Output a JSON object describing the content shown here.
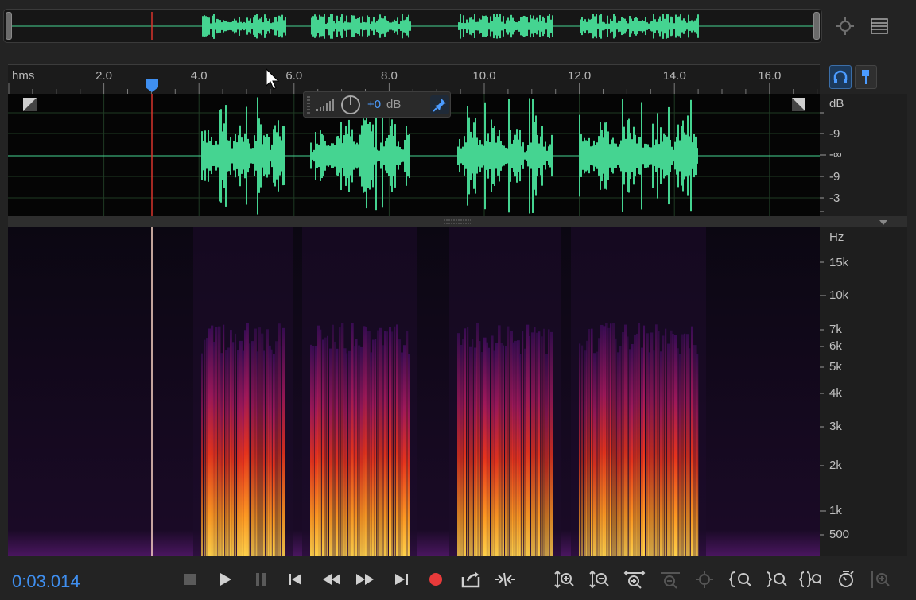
{
  "ruler": {
    "unit_label": "hms",
    "ticks": [
      {
        "value": 2.0,
        "label": "2.0"
      },
      {
        "value": 4.0,
        "label": "4.0"
      },
      {
        "value": 6.0,
        "label": "6.0"
      },
      {
        "value": 8.0,
        "label": "8.0"
      },
      {
        "value": 10.0,
        "label": "10.0"
      },
      {
        "value": 12.0,
        "label": "12.0"
      },
      {
        "value": 14.0,
        "label": "14.0"
      },
      {
        "value": 16.0,
        "label": "16.0"
      }
    ]
  },
  "waveform": {
    "hud_value": "+0",
    "hud_unit": "dB",
    "db_unit": "dB",
    "db_labels": [
      "-9",
      "-∞",
      "-9",
      "-3"
    ]
  },
  "spectrogram": {
    "hz_unit": "Hz",
    "hz_labels": [
      "15k",
      "10k",
      "7k",
      "6k",
      "5k",
      "4k",
      "3k",
      "2k",
      "1k",
      "500"
    ]
  },
  "transport": {
    "current_time": "0:03.014"
  },
  "colors": {
    "waveform": "#45d491",
    "playhead": "#d8342c",
    "accent": "#3f8ff0",
    "record": "#e83a3a"
  },
  "icons": {
    "overview": [
      "zoom-fit-icon",
      "menu-icon"
    ],
    "side": [
      "headphones-icon",
      "marker-pin-icon"
    ],
    "transport": [
      "stop-icon",
      "play-icon",
      "pause-icon",
      "skip-to-start-icon",
      "rewind-icon",
      "fast-forward-icon",
      "skip-to-end-icon",
      "record-icon",
      "loop-playback-icon",
      "skip-selection-icon"
    ],
    "zoom": [
      "zoom-in-amplitude-icon",
      "zoom-out-amplitude-icon",
      "zoom-in-time-icon",
      "zoom-out-full-icon",
      "zoom-selection-icon",
      "zoom-in-left-icon",
      "zoom-in-right-icon",
      "zoom-out-time-icon",
      "zoom-reset-icon",
      "zoom-extra-icon"
    ]
  }
}
